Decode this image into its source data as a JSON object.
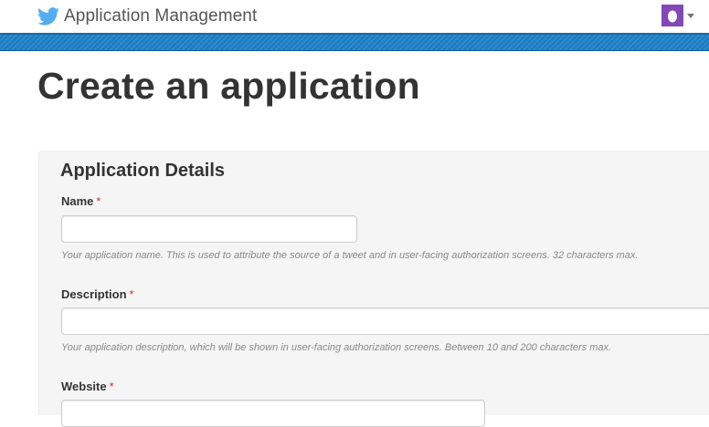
{
  "header": {
    "logo_icon": "twitter-bird-icon",
    "title": "Application Management",
    "avatar_icon": "egg-avatar-icon",
    "menu_icon": "caret-down-icon",
    "colors": {
      "brand": "#55acee",
      "band": "#1d80c6",
      "avatar": "#8348b4"
    }
  },
  "page": {
    "title": "Create an application"
  },
  "form": {
    "section_title": "Application Details",
    "required_marker": "*",
    "fields": {
      "name": {
        "label": "Name",
        "value": "",
        "help": "Your application name. This is used to attribute the source of a tweet and in user-facing authorization screens. 32 characters max."
      },
      "description": {
        "label": "Description",
        "value": "",
        "help": "Your application description, which will be shown in user-facing authorization screens. Between 10 and 200 characters max."
      },
      "website": {
        "label": "Website",
        "value": ""
      }
    }
  }
}
